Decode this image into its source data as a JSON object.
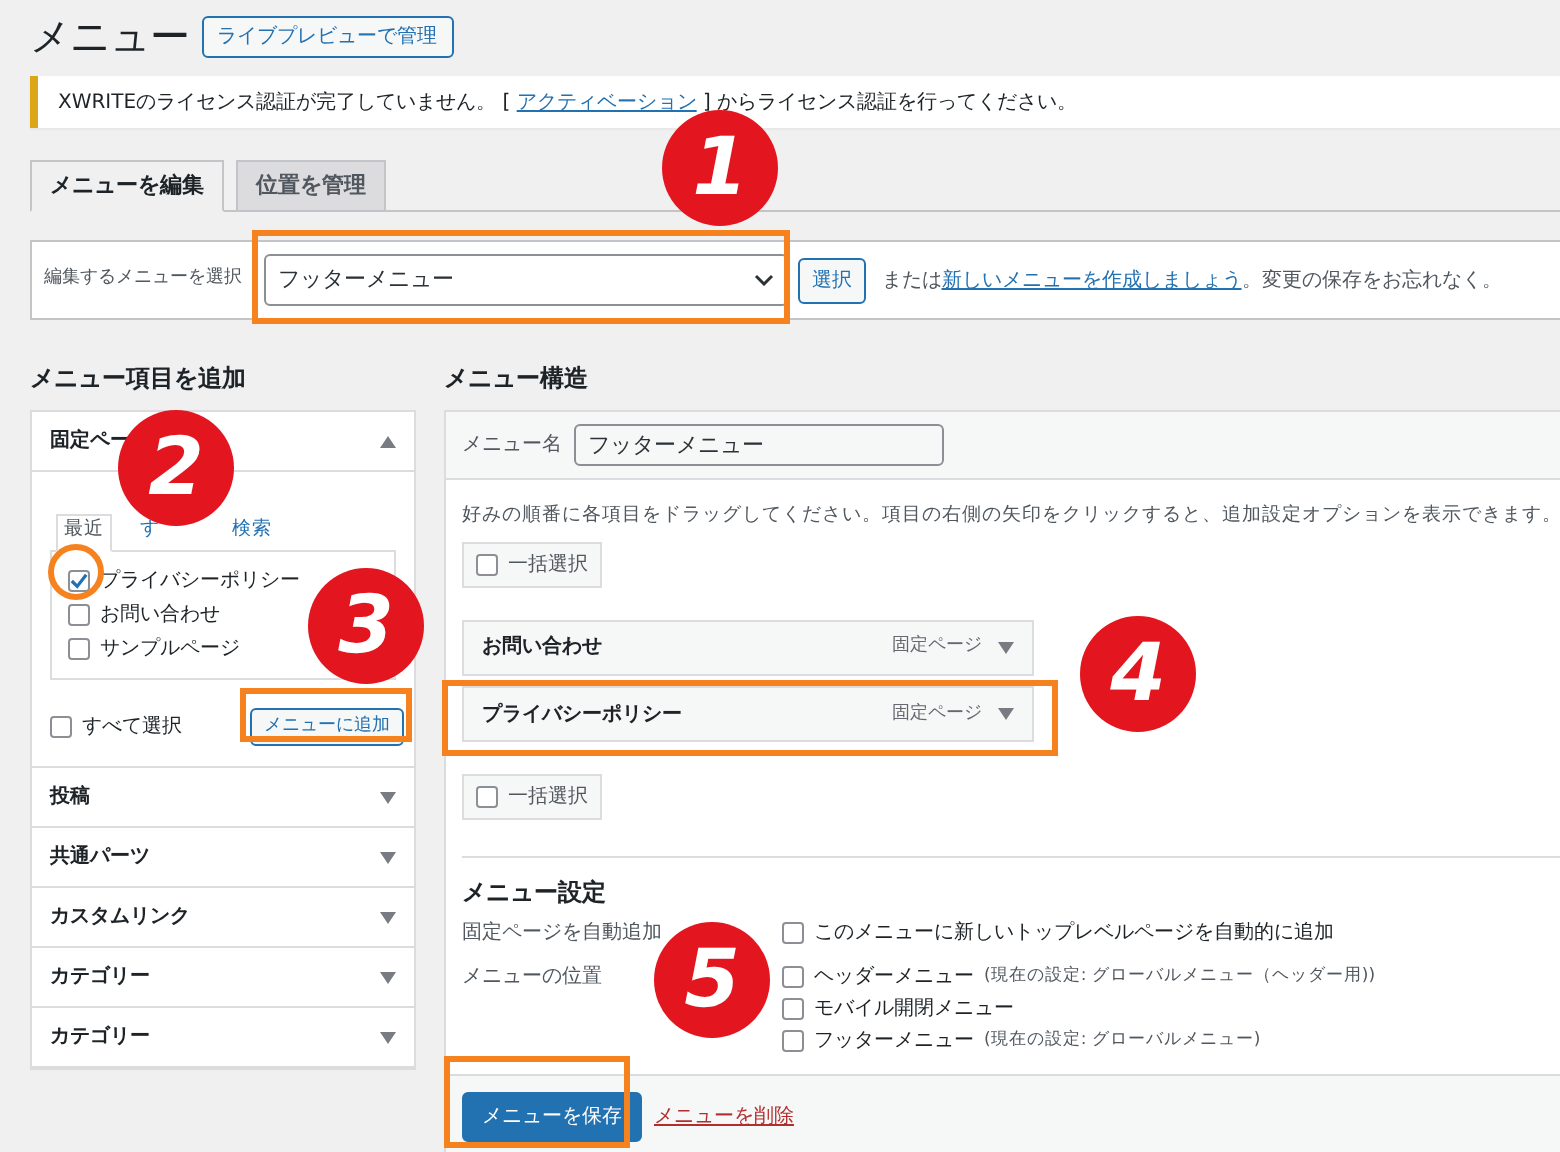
{
  "page_title": "メニュー",
  "live_preview_button": "ライブプレビューで管理",
  "notice": {
    "before": "XWRITEのライセンス認証が完了していません。 [ ",
    "link": "アクティベーション",
    "after": " ] からライセンス認証を行ってください。"
  },
  "tabs": [
    {
      "label": "メニューを編集",
      "selected": true
    },
    {
      "label": "位置を管理",
      "selected": false
    }
  ],
  "menu_select": {
    "label": "編集するメニューを選択",
    "value": "フッターメニュー",
    "button": "選択",
    "before_link": "または",
    "link": "新しいメニューを作成しましょう",
    "after_link": "。変更の保存をお忘れなく。"
  },
  "add_items": {
    "heading": "メニュー項目を追加",
    "sections": [
      {
        "title": "固定ペー",
        "expanded": true,
        "tabs": [
          {
            "label": "最近",
            "selected": true
          },
          {
            "label": "す",
            "selected": false
          },
          {
            "label": "検索",
            "selected": false
          }
        ],
        "items": [
          {
            "label": "プライバシーポリシー",
            "checked": true
          },
          {
            "label": "お問い合わせ",
            "checked": false
          },
          {
            "label": "サンプルページ",
            "checked": false
          }
        ],
        "select_all": {
          "label": "すべて選択",
          "checked": false
        },
        "add_button": "メニューに追加"
      },
      {
        "title": "投稿",
        "expanded": false
      },
      {
        "title": "共通パーツ",
        "expanded": false
      },
      {
        "title": "カスタムリンク",
        "expanded": false
      },
      {
        "title": "カテゴリー",
        "expanded": false
      },
      {
        "title": "カテゴリー",
        "expanded": false
      }
    ]
  },
  "structure": {
    "heading": "メニュー構造",
    "name_label": "メニュー名",
    "name_value": "フッターメニュー",
    "instructions": "好みの順番に各項目をドラッグしてください。項目の右側の矢印をクリックすると、追加設定オプションを表示できます。",
    "bulk_select_top": {
      "label": "一括選択",
      "checked": false
    },
    "items": [
      {
        "title": "お問い合わせ",
        "type": "固定ページ"
      },
      {
        "title": "プライバシーポリシー",
        "type": "固定ページ"
      }
    ],
    "bulk_select_bottom": {
      "label": "一括選択",
      "checked": false
    },
    "settings": {
      "heading": "メニュー設定",
      "rows": [
        {
          "label": "固定ページを自動追加",
          "options": [
            {
              "label": "このメニューに新しいトップレベルページを自動的に追加",
              "checked": false
            }
          ]
        },
        {
          "label": "メニューの位置",
          "options": [
            {
              "label": "ヘッダーメニュー",
              "note": "(現在の設定: グローバルメニュー（ヘッダー用))",
              "checked": false
            },
            {
              "label": "モバイル開閉メニュー",
              "checked": false
            },
            {
              "label": "フッターメニュー",
              "note": "(現在の設定: グローバルメニュー)",
              "checked": false
            }
          ]
        }
      ]
    },
    "save_button": "メニューを保存",
    "delete_link": "メニューを削除"
  },
  "annotations": [
    {
      "number": "1"
    },
    {
      "number": "2"
    },
    {
      "number": "3"
    },
    {
      "number": "4"
    },
    {
      "number": "5"
    }
  ]
}
